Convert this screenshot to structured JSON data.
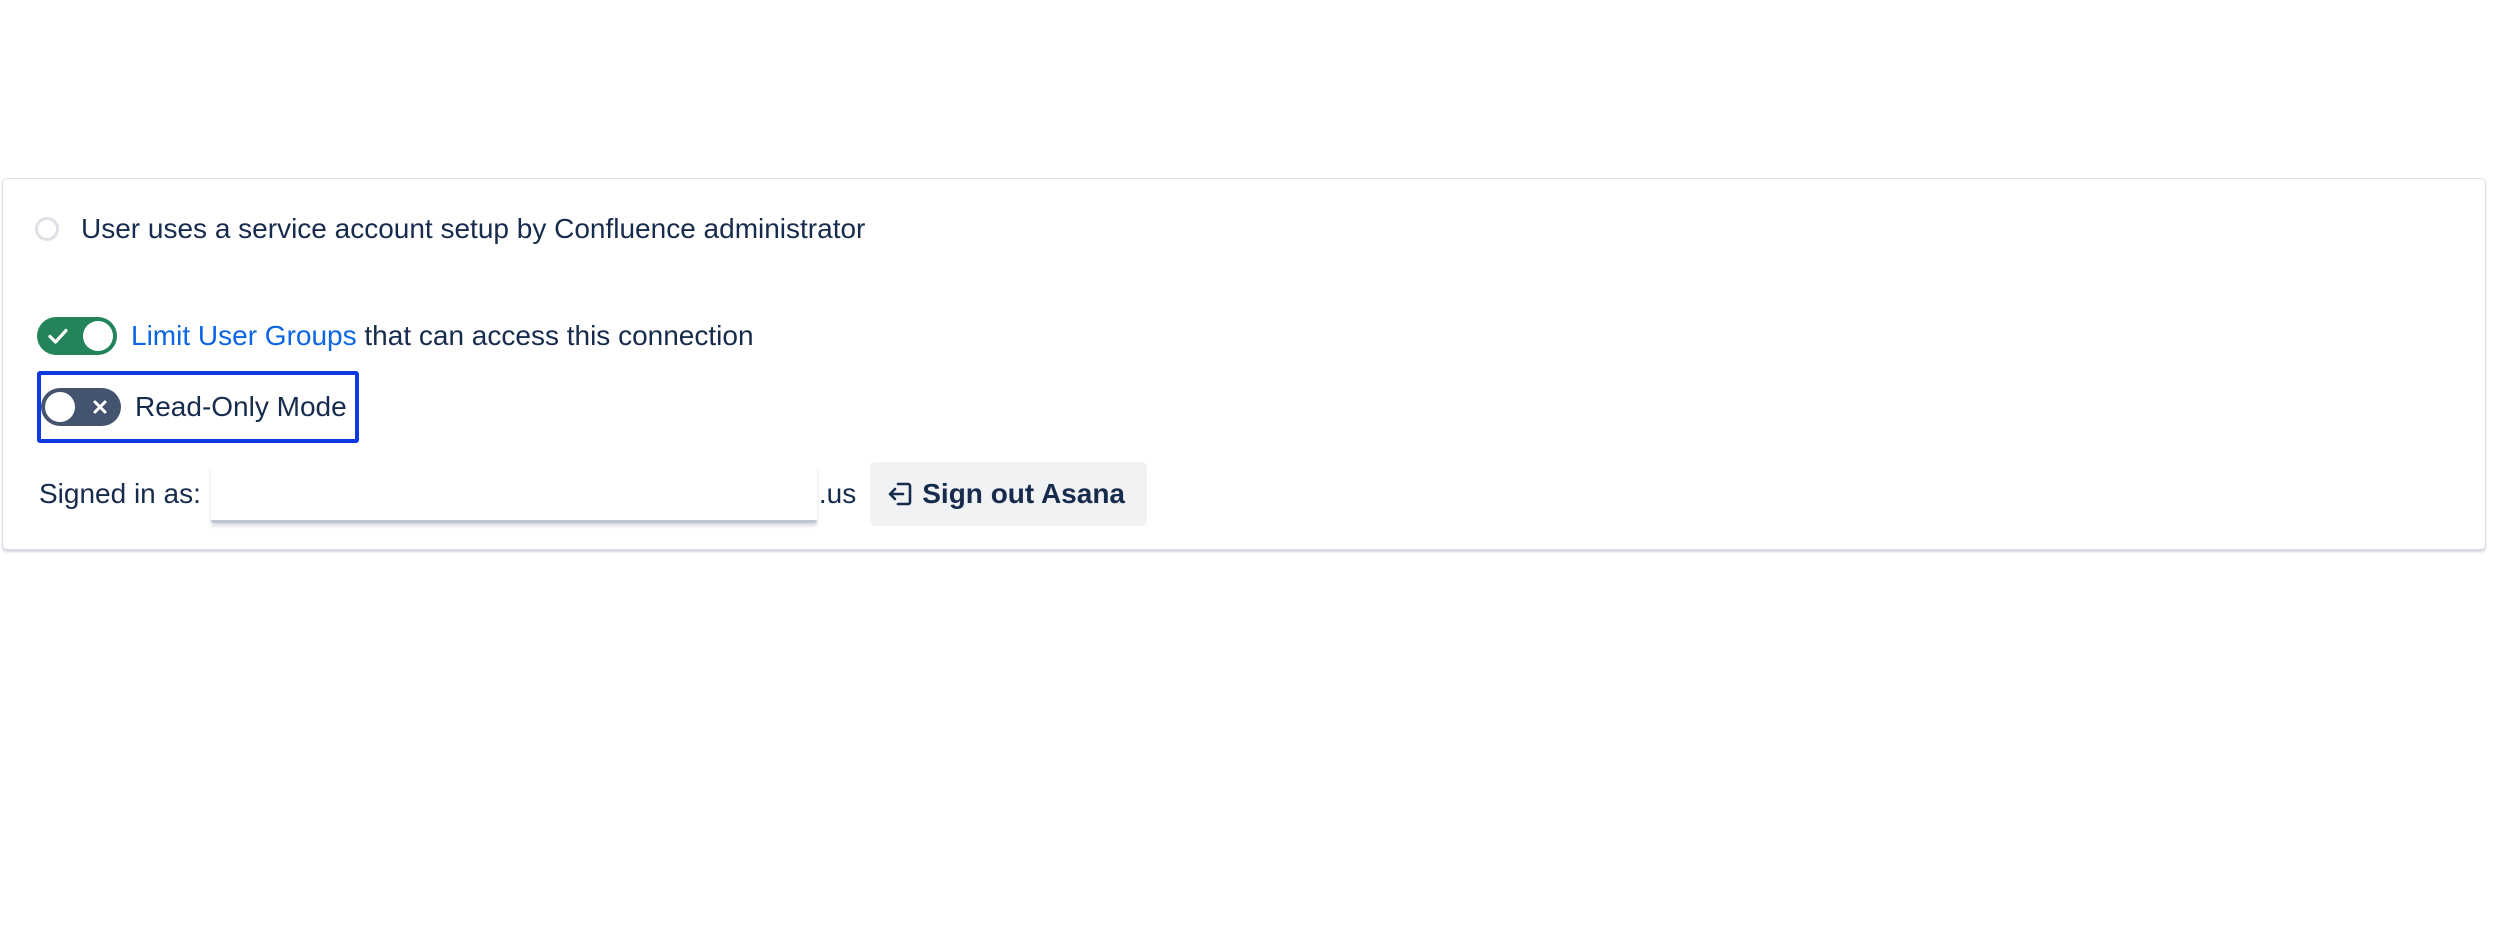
{
  "auth_option": {
    "label": "User uses a service account setup by Confluence administrator",
    "selected": false
  },
  "limit_groups": {
    "enabled": true,
    "link_text": "Limit User Groups",
    "rest_text": " that can access this connection"
  },
  "read_only": {
    "enabled": false,
    "label": "Read-Only Mode"
  },
  "account": {
    "signed_in_label": "Signed in as:",
    "email_suffix": ".us",
    "signout_label": "Sign out Asana"
  },
  "icons": {
    "toggle_on": "checkmark-icon",
    "toggle_off": "cross-icon",
    "signout": "sign-out-icon"
  },
  "colors": {
    "toggle_on": "#23845a",
    "toggle_off": "#44546f",
    "link": "#0c66e4",
    "focus_outline": "#0c3ae0",
    "text": "#172b4d"
  }
}
